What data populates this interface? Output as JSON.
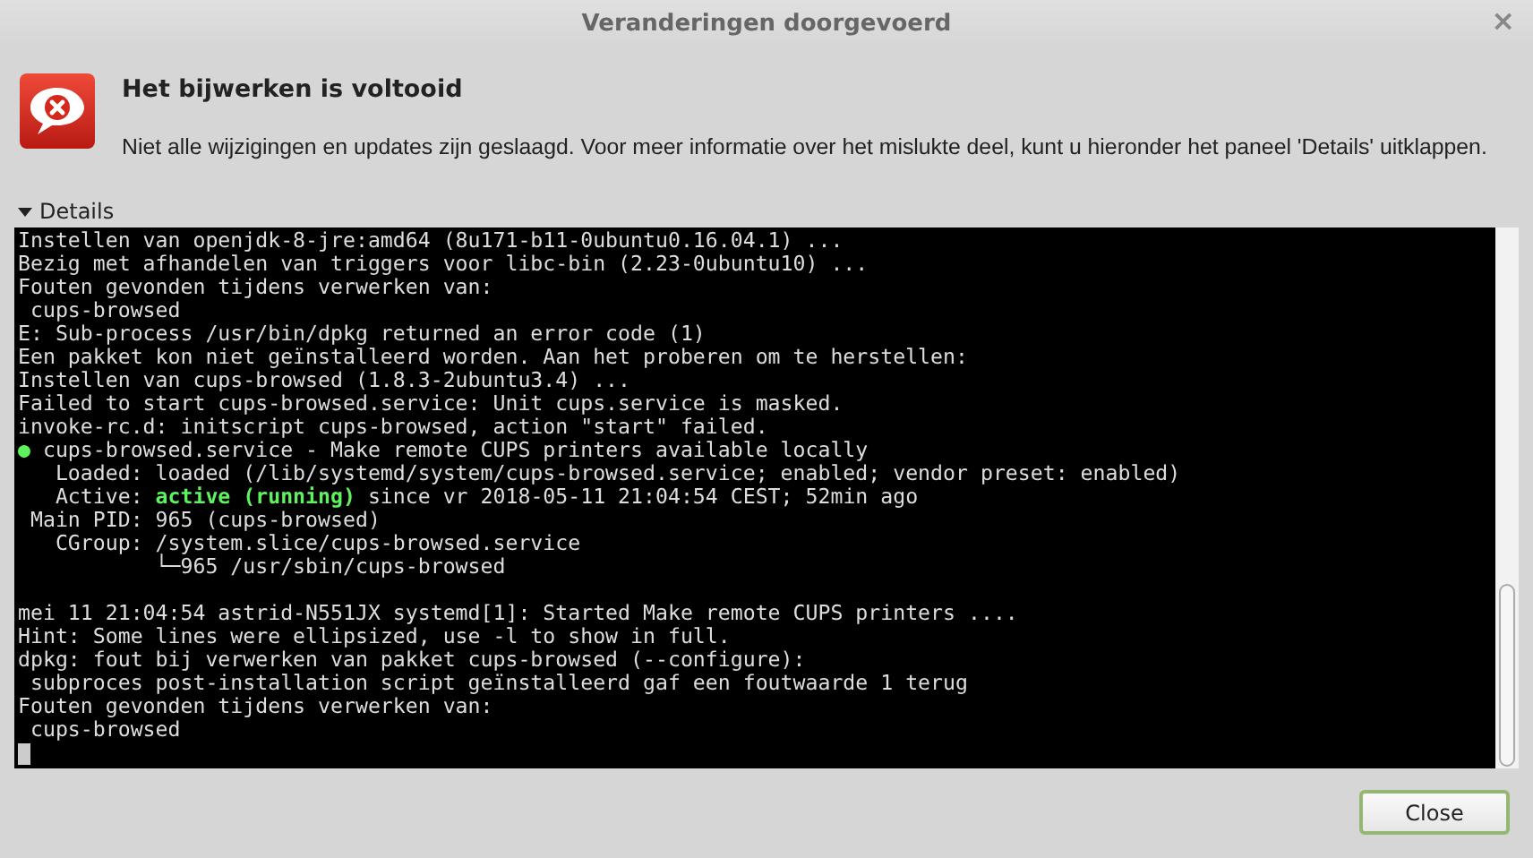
{
  "window": {
    "title": "Veranderingen doorgevoerd",
    "close_symbol": "×"
  },
  "heading": "Het bijwerken is voltooid",
  "message": "Niet alle wijzigingen en updates zijn geslaagd. Voor meer informatie over het mislukte deel, kunt u hieronder het paneel 'Details' uitklappen.",
  "details": {
    "label": "Details",
    "expanded": true
  },
  "terminal": {
    "lines": [
      {
        "kind": "text",
        "segments": [
          {
            "text": "Instellen van openjdk-8-jre:amd64 (8u171-b11-0ubuntu0.16.04.1) ...",
            "kind": "plain"
          }
        ]
      },
      {
        "kind": "text",
        "segments": [
          {
            "text": "Bezig met afhandelen van triggers voor libc-bin (2.23-0ubuntu10) ...",
            "kind": "plain"
          }
        ]
      },
      {
        "kind": "text",
        "segments": [
          {
            "text": "Fouten gevonden tijdens verwerken van:",
            "kind": "plain"
          }
        ]
      },
      {
        "kind": "text",
        "segments": [
          {
            "text": " cups-browsed",
            "kind": "plain"
          }
        ]
      },
      {
        "kind": "text",
        "segments": [
          {
            "text": "E: Sub-process /usr/bin/dpkg returned an error code (1)",
            "kind": "plain"
          }
        ]
      },
      {
        "kind": "text",
        "segments": [
          {
            "text": "Een pakket kon niet geïnstalleerd worden. Aan het proberen om te herstellen:",
            "kind": "plain"
          }
        ]
      },
      {
        "kind": "text",
        "segments": [
          {
            "text": "Instellen van cups-browsed (1.8.3-2ubuntu3.4) ...",
            "kind": "plain"
          }
        ]
      },
      {
        "kind": "text",
        "segments": [
          {
            "text": "Failed to start cups-browsed.service: Unit cups.service is masked.",
            "kind": "plain"
          }
        ]
      },
      {
        "kind": "text",
        "segments": [
          {
            "text": "invoke-rc.d: initscript cups-browsed, action \"start\" failed.",
            "kind": "plain"
          }
        ]
      },
      {
        "kind": "text",
        "segments": [
          {
            "text": "●",
            "kind": "highlight"
          },
          {
            "text": " cups-browsed.service - Make remote CUPS printers available locally",
            "kind": "plain"
          }
        ]
      },
      {
        "kind": "text",
        "segments": [
          {
            "text": "   Loaded: loaded (/lib/systemd/system/cups-browsed.service; enabled; vendor preset: enabled)",
            "kind": "plain"
          }
        ]
      },
      {
        "kind": "text",
        "segments": [
          {
            "text": "   Active: ",
            "kind": "plain"
          },
          {
            "text": "active (running)",
            "kind": "highlight"
          },
          {
            "text": " since vr 2018-05-11 21:04:54 CEST; 52min ago",
            "kind": "plain"
          }
        ]
      },
      {
        "kind": "text",
        "segments": [
          {
            "text": " Main PID: 965 (cups-browsed)",
            "kind": "plain"
          }
        ]
      },
      {
        "kind": "text",
        "segments": [
          {
            "text": "   CGroup: /system.slice/cups-browsed.service",
            "kind": "plain"
          }
        ]
      },
      {
        "kind": "text",
        "segments": [
          {
            "text": "           └─965 /usr/sbin/cups-browsed",
            "kind": "plain"
          }
        ]
      },
      {
        "kind": "blank"
      },
      {
        "kind": "text",
        "segments": [
          {
            "text": "mei 11 21:04:54 astrid-N551JX systemd[1]: Started Make remote CUPS printers ....",
            "kind": "plain"
          }
        ]
      },
      {
        "kind": "text",
        "segments": [
          {
            "text": "Hint: Some lines were ellipsized, use -l to show in full.",
            "kind": "plain"
          }
        ]
      },
      {
        "kind": "text",
        "segments": [
          {
            "text": "dpkg: fout bij verwerken van pakket cups-browsed (--configure):",
            "kind": "plain"
          }
        ]
      },
      {
        "kind": "text",
        "segments": [
          {
            "text": " subproces post-installation script geïnstalleerd gaf een foutwaarde 1 terug",
            "kind": "plain"
          }
        ]
      },
      {
        "kind": "text",
        "segments": [
          {
            "text": "Fouten gevonden tijdens verwerken van:",
            "kind": "plain"
          }
        ]
      },
      {
        "kind": "text",
        "segments": [
          {
            "text": " cups-browsed",
            "kind": "plain"
          }
        ]
      },
      {
        "kind": "cursor"
      }
    ]
  },
  "buttons": [
    {
      "label": "Close"
    }
  ]
}
